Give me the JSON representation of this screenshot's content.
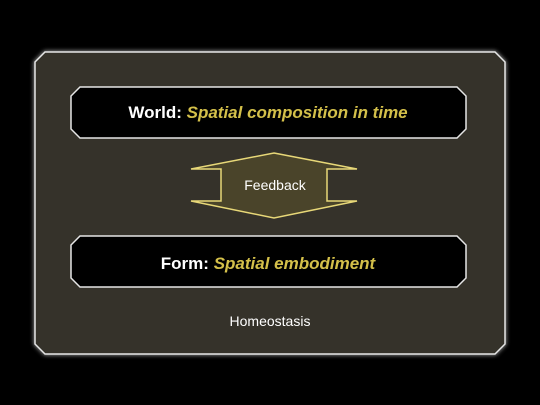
{
  "colors": {
    "background": "#000000",
    "panel_fill": "#34332b",
    "panel_border": "#e6e6e6",
    "box_fill": "#000000",
    "box_border": "#e6e6e6",
    "accent": "#d4c04a",
    "arrow_fill": "#4a442a",
    "arrow_border": "#e8d878",
    "text": "#ffffff"
  },
  "world_box": {
    "prefix": "World:",
    "emphasis": "Spatial composition in time"
  },
  "form_box": {
    "prefix": "Form:",
    "emphasis": "Spatial embodiment"
  },
  "feedback": {
    "label": "Feedback",
    "icon": "double-headed-vertical-arrow"
  },
  "homeostasis": {
    "label": "Homeostasis"
  }
}
